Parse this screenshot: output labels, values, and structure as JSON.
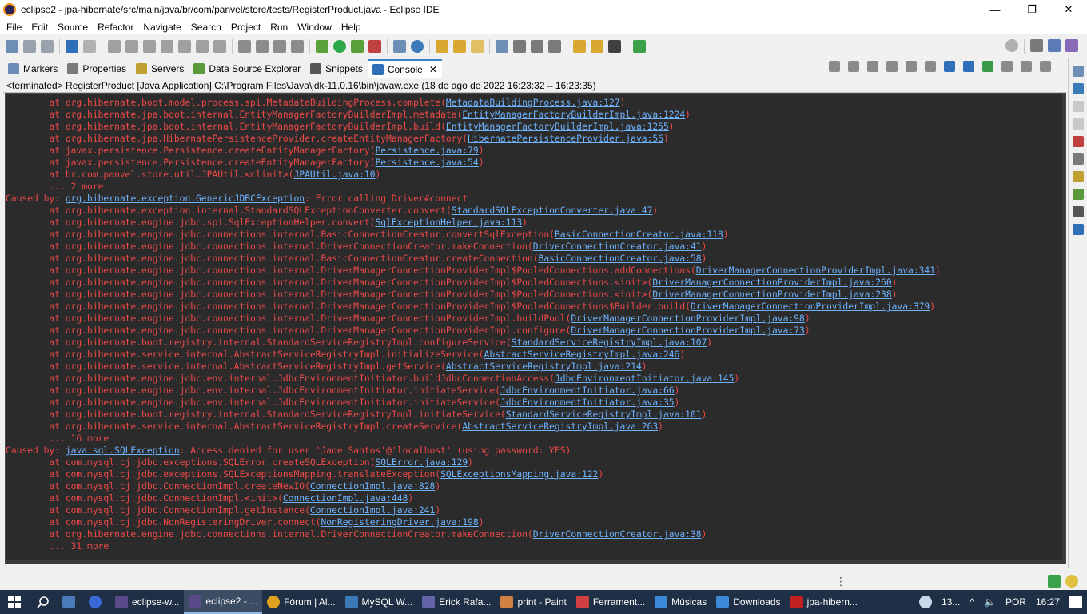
{
  "window": {
    "title": "eclipse2 - jpa-hibernate/src/main/java/br/com/panvel/store/tests/RegisterProduct.java - Eclipse IDE",
    "minimize": "—",
    "maximize": "❐",
    "close": "✕"
  },
  "menu": [
    "File",
    "Edit",
    "Source",
    "Refactor",
    "Navigate",
    "Search",
    "Project",
    "Run",
    "Window",
    "Help"
  ],
  "view_tabs": [
    {
      "label": "Markers",
      "icon": "markers-icon",
      "color": "#6b8cb8"
    },
    {
      "label": "Properties",
      "icon": "properties-icon",
      "color": "#7a7a7a"
    },
    {
      "label": "Servers",
      "icon": "servers-icon",
      "color": "#c0a030"
    },
    {
      "label": "Data Source Explorer",
      "icon": "data-source-icon",
      "color": "#5a9a3a"
    },
    {
      "label": "Snippets",
      "icon": "snippets-icon",
      "color": "#555555"
    },
    {
      "label": "Console",
      "icon": "console-icon",
      "color": "#2f6fb8",
      "active": true,
      "close": "✕"
    }
  ],
  "console_status": "<terminated> RegisterProduct [Java Application] C:\\Program Files\\Java\\jdk-11.0.16\\bin\\javaw.exe  (18 de ago de 2022 16:23:32 – 16:23:35)",
  "console_lines": [
    {
      "text": "        at org.hibernate.boot.model.process.spi.MetadataBuildingProcess.complete(",
      "link": "MetadataBuildingProcess.java:127",
      "tail": ")"
    },
    {
      "text": "        at org.hibernate.jpa.boot.internal.EntityManagerFactoryBuilderImpl.metadata(",
      "link": "EntityManagerFactoryBuilderImpl.java:1224",
      "tail": ")"
    },
    {
      "text": "        at org.hibernate.jpa.boot.internal.EntityManagerFactoryBuilderImpl.build(",
      "link": "EntityManagerFactoryBuilderImpl.java:1255",
      "tail": ")"
    },
    {
      "text": "        at org.hibernate.jpa.HibernatePersistenceProvider.createEntityManagerFactory(",
      "link": "HibernatePersistenceProvider.java:56",
      "tail": ")"
    },
    {
      "text": "        at javax.persistence.Persistence.createEntityManagerFactory(",
      "link": "Persistence.java:79",
      "tail": ")"
    },
    {
      "text": "        at javax.persistence.Persistence.createEntityManagerFactory(",
      "link": "Persistence.java:54",
      "tail": ")"
    },
    {
      "text": "        at br.com.panvel.store.util.JPAUtil.<clinit>(",
      "link": "JPAUtil.java:10",
      "tail": ")"
    },
    {
      "text": "        ... 2 more",
      "link": "",
      "tail": ""
    },
    {
      "text": "Caused by: ",
      "link": "org.hibernate.exception.GenericJDBCException",
      "tail": ": Error calling Driver#connect"
    },
    {
      "text": "        at org.hibernate.exception.internal.StandardSQLExceptionConverter.convert(",
      "link": "StandardSQLExceptionConverter.java:47",
      "tail": ")"
    },
    {
      "text": "        at org.hibernate.engine.jdbc.spi.SqlExceptionHelper.convert(",
      "link": "SqlExceptionHelper.java:113",
      "tail": ")"
    },
    {
      "text": "        at org.hibernate.engine.jdbc.connections.internal.BasicConnectionCreator.convertSqlException(",
      "link": "BasicConnectionCreator.java:118",
      "tail": ")"
    },
    {
      "text": "        at org.hibernate.engine.jdbc.connections.internal.DriverConnectionCreator.makeConnection(",
      "link": "DriverConnectionCreator.java:41",
      "tail": ")"
    },
    {
      "text": "        at org.hibernate.engine.jdbc.connections.internal.BasicConnectionCreator.createConnection(",
      "link": "BasicConnectionCreator.java:58",
      "tail": ")"
    },
    {
      "text": "        at org.hibernate.engine.jdbc.connections.internal.DriverManagerConnectionProviderImpl$PooledConnections.addConnections(",
      "link": "DriverManagerConnectionProviderImpl.java:341",
      "tail": ")"
    },
    {
      "text": "        at org.hibernate.engine.jdbc.connections.internal.DriverManagerConnectionProviderImpl$PooledConnections.<init>(",
      "link": "DriverManagerConnectionProviderImpl.java:260",
      "tail": ")"
    },
    {
      "text": "        at org.hibernate.engine.jdbc.connections.internal.DriverManagerConnectionProviderImpl$PooledConnections.<init>(",
      "link": "DriverManagerConnectionProviderImpl.java:238",
      "tail": ")"
    },
    {
      "text": "        at org.hibernate.engine.jdbc.connections.internal.DriverManagerConnectionProviderImpl$PooledConnections$Builder.build(",
      "link": "DriverManagerConnectionProviderImpl.java:379",
      "tail": ")"
    },
    {
      "text": "        at org.hibernate.engine.jdbc.connections.internal.DriverManagerConnectionProviderImpl.buildPool(",
      "link": "DriverManagerConnectionProviderImpl.java:98",
      "tail": ")"
    },
    {
      "text": "        at org.hibernate.engine.jdbc.connections.internal.DriverManagerConnectionProviderImpl.configure(",
      "link": "DriverManagerConnectionProviderImpl.java:73",
      "tail": ")"
    },
    {
      "text": "        at org.hibernate.boot.registry.internal.StandardServiceRegistryImpl.configureService(",
      "link": "StandardServiceRegistryImpl.java:107",
      "tail": ")"
    },
    {
      "text": "        at org.hibernate.service.internal.AbstractServiceRegistryImpl.initializeService(",
      "link": "AbstractServiceRegistryImpl.java:246",
      "tail": ")"
    },
    {
      "text": "        at org.hibernate.service.internal.AbstractServiceRegistryImpl.getService(",
      "link": "AbstractServiceRegistryImpl.java:214",
      "tail": ")"
    },
    {
      "text": "        at org.hibernate.engine.jdbc.env.internal.JdbcEnvironmentInitiator.buildJdbcConnectionAccess(",
      "link": "JdbcEnvironmentInitiator.java:145",
      "tail": ")"
    },
    {
      "text": "        at org.hibernate.engine.jdbc.env.internal.JdbcEnvironmentInitiator.initiateService(",
      "link": "JdbcEnvironmentInitiator.java:66",
      "tail": ")"
    },
    {
      "text": "        at org.hibernate.engine.jdbc.env.internal.JdbcEnvironmentInitiator.initiateService(",
      "link": "JdbcEnvironmentInitiator.java:35",
      "tail": ")"
    },
    {
      "text": "        at org.hibernate.boot.registry.internal.StandardServiceRegistryImpl.initiateService(",
      "link": "StandardServiceRegistryImpl.java:101",
      "tail": ")"
    },
    {
      "text": "        at org.hibernate.service.internal.AbstractServiceRegistryImpl.createService(",
      "link": "AbstractServiceRegistryImpl.java:263",
      "tail": ")"
    },
    {
      "text": "        ... 16 more",
      "link": "",
      "tail": ""
    },
    {
      "text": "Caused by: ",
      "link": "java.sql.SQLException",
      "tail": ": Access denied for user 'Jade Santos'@'localhost' (using password: YES)",
      "cursor": true
    },
    {
      "text": "        at com.mysql.cj.jdbc.exceptions.SQLError.createSQLException(",
      "link": "SQLError.java:129",
      "tail": ")"
    },
    {
      "text": "        at com.mysql.cj.jdbc.exceptions.SQLExceptionsMapping.translateException(",
      "link": "SQLExceptionsMapping.java:122",
      "tail": ")"
    },
    {
      "text": "        at com.mysql.cj.jdbc.ConnectionImpl.createNewIO(",
      "link": "ConnectionImpl.java:828",
      "tail": ")"
    },
    {
      "text": "        at com.mysql.cj.jdbc.ConnectionImpl.<init>(",
      "link": "ConnectionImpl.java:448",
      "tail": ")"
    },
    {
      "text": "        at com.mysql.cj.jdbc.ConnectionImpl.getInstance(",
      "link": "ConnectionImpl.java:241",
      "tail": ")"
    },
    {
      "text": "        at com.mysql.cj.jdbc.NonRegisteringDriver.connect(",
      "link": "NonRegisteringDriver.java:198",
      "tail": ")"
    },
    {
      "text": "        at org.hibernate.engine.jdbc.connections.internal.DriverConnectionCreator.makeConnection(",
      "link": "DriverConnectionCreator.java:38",
      "tail": ")"
    },
    {
      "text": "        ... 31 more",
      "link": "",
      "tail": ""
    }
  ],
  "taskbar": {
    "items": [
      {
        "label": "eclipse-w...",
        "icon": "eclipse-icon",
        "color": "#5a4a8a"
      },
      {
        "label": "eclipse2 - ...",
        "icon": "eclipse-icon",
        "color": "#5a4a8a",
        "active": true
      },
      {
        "label": "Fórum | Al...",
        "icon": "chrome-icon",
        "color": "#e0a020"
      },
      {
        "label": "MySQL W...",
        "icon": "mysql-icon",
        "color": "#3a7ab8"
      },
      {
        "label": "Erick Rafa...",
        "icon": "teams-icon",
        "color": "#6264a7"
      },
      {
        "label": "print - Paint",
        "icon": "paint-icon",
        "color": "#d08040"
      },
      {
        "label": "Ferrament...",
        "icon": "snipping-icon",
        "color": "#d04040"
      },
      {
        "label": "Músicas",
        "icon": "music-icon",
        "color": "#3a8ad8"
      },
      {
        "label": "Downloads",
        "icon": "downloads-icon",
        "color": "#3a8ad8"
      },
      {
        "label": "jpa-hibern...",
        "icon": "pdf-icon",
        "color": "#c02020"
      }
    ],
    "weather": "13...",
    "language": "POR",
    "time": "16:27"
  },
  "colors": {
    "console_bg": "#2b2b2b",
    "error_text": "#f04848",
    "link_text": "#6fb4ff",
    "taskbar_bg": "#1f2f45",
    "active_tab_accent": "#3d7ec8"
  }
}
